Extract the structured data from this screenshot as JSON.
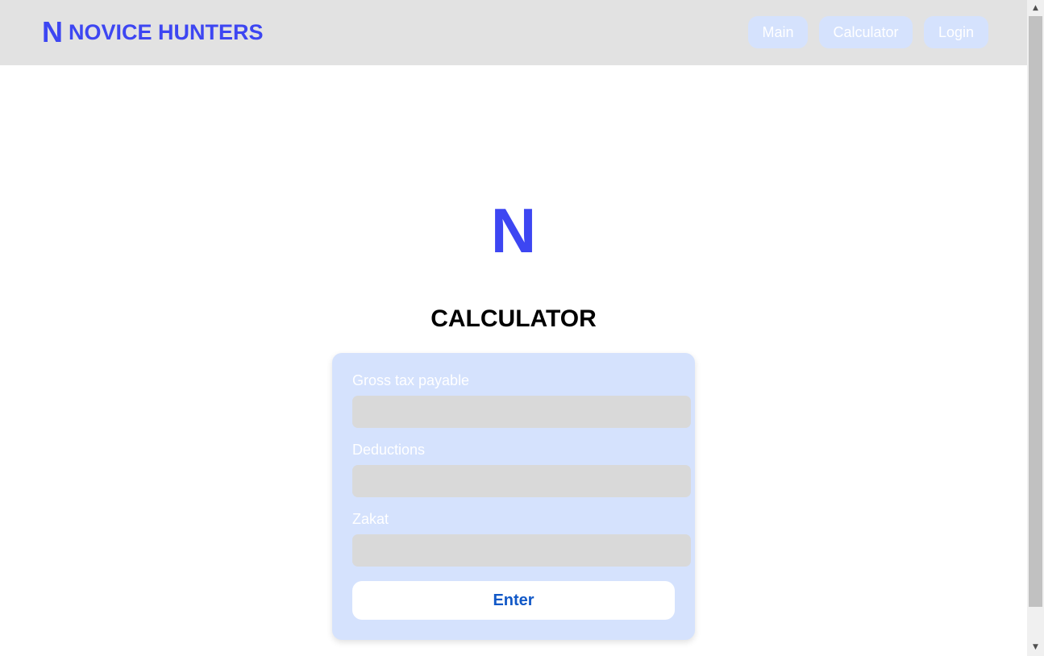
{
  "header": {
    "brand_mark": "N",
    "brand_name": "NOVICE HUNTERS",
    "nav": [
      {
        "label": "Main"
      },
      {
        "label": "Calculator"
      },
      {
        "label": "Login"
      }
    ]
  },
  "hero": {
    "logo": "N",
    "title": "CALCULATOR"
  },
  "form": {
    "fields": [
      {
        "label": "Gross tax payable",
        "value": "",
        "placeholder": ""
      },
      {
        "label": "Deductions",
        "value": "",
        "placeholder": ""
      },
      {
        "label": "Zakat",
        "value": "",
        "placeholder": ""
      }
    ],
    "submit_label": "Enter"
  },
  "scrollbar": {
    "up_icon": "▲",
    "down_icon": "▼"
  },
  "colors": {
    "brand": "#3d46f2",
    "header_bg": "#e2e2e2",
    "card_bg": "#d5e2fd",
    "input_bg": "#d9d9d9",
    "button_text": "#1158c7"
  }
}
